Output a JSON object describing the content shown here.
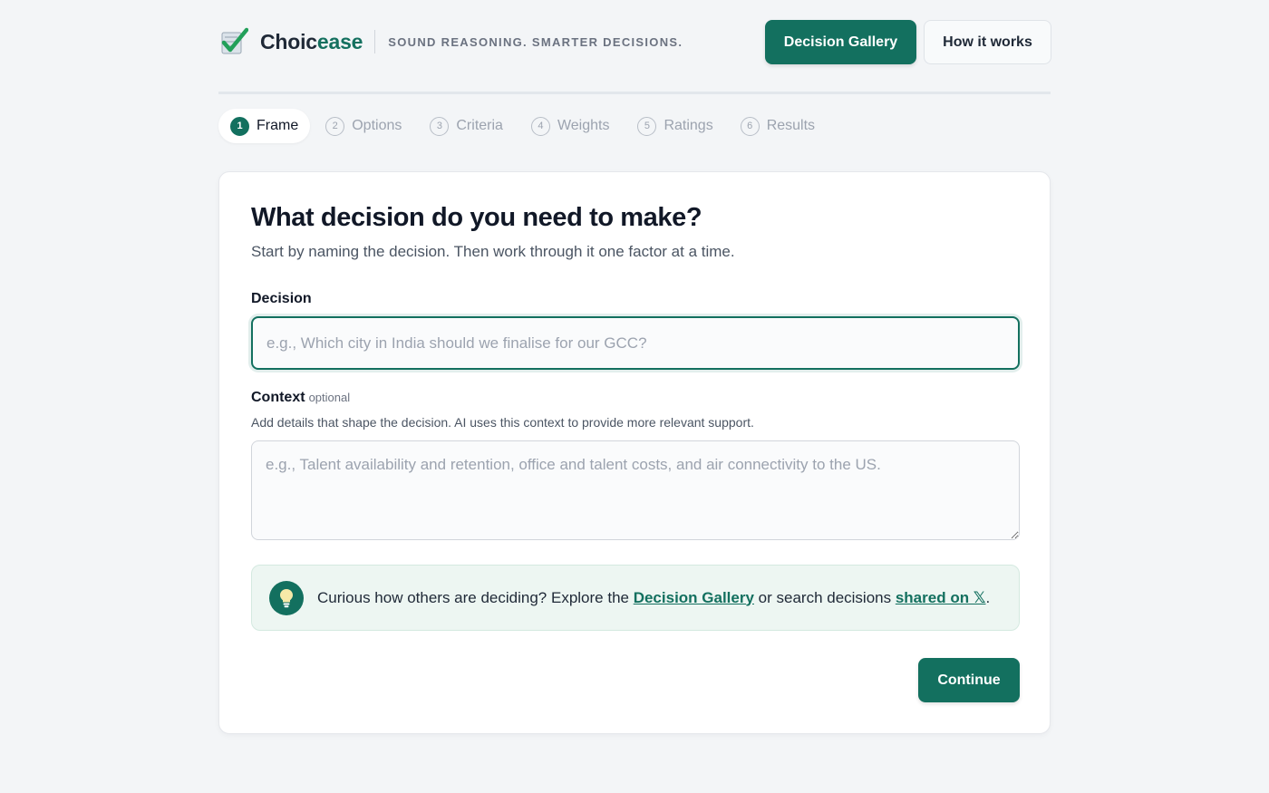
{
  "header": {
    "brand_main": "Choic",
    "brand_accent": "ease",
    "tagline": "SOUND REASONING. SMARTER DECISIONS.",
    "gallery_button": "Decision Gallery",
    "how_button": "How it works",
    "logo_icon": "checkmark-clipboard-icon"
  },
  "steps": [
    {
      "num": "1",
      "label": "Frame",
      "active": true
    },
    {
      "num": "2",
      "label": "Options",
      "active": false
    },
    {
      "num": "3",
      "label": "Criteria",
      "active": false
    },
    {
      "num": "4",
      "label": "Weights",
      "active": false
    },
    {
      "num": "5",
      "label": "Ratings",
      "active": false
    },
    {
      "num": "6",
      "label": "Results",
      "active": false
    }
  ],
  "form": {
    "title": "What decision do you need to make?",
    "subtitle": "Start by naming the decision. Then work through it one factor at a time.",
    "decision_label": "Decision",
    "decision_value": "",
    "decision_placeholder": "e.g., Which city in India should we finalise for our GCC?",
    "context_label": "Context",
    "context_optional": "optional",
    "context_help": "Add details that shape the decision. AI uses this context to provide more relevant support.",
    "context_value": "",
    "context_placeholder": "e.g., Talent availability and retention, office and talent costs, and air connectivity to the US."
  },
  "tip": {
    "icon": "lightbulb-icon",
    "text_before": "Curious how others are deciding? Explore the ",
    "gallery_link": "Decision Gallery",
    "text_middle": " or search decisions ",
    "x_link": "shared on 𝕏",
    "text_after": "."
  },
  "actions": {
    "continue": "Continue"
  },
  "colors": {
    "accent": "#13705f",
    "background": "#f3f5f7",
    "tip_background": "#edf6f2"
  }
}
